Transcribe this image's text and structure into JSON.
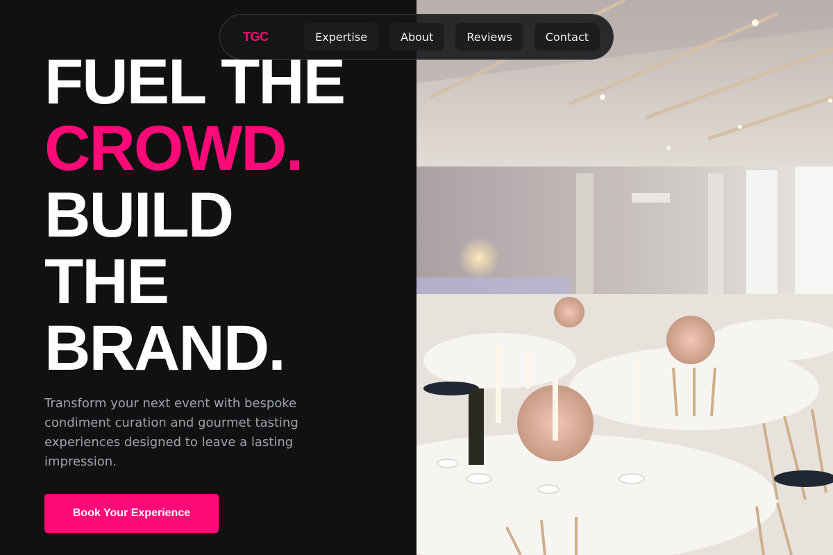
{
  "nav": {
    "brand": "TGC",
    "links": [
      {
        "label": "Expertise"
      },
      {
        "label": "About"
      },
      {
        "label": "Reviews"
      },
      {
        "label": "Contact"
      }
    ]
  },
  "hero": {
    "headline_lines": [
      "FUEL THE",
      "CROWD.",
      "BUILD",
      "THE",
      "BRAND."
    ],
    "subtitle": "Transform your next event with bespoke condiment curation and gourmet tasting experiences designed to leave a lasting impression.",
    "cta_label": "Book Your Experience"
  },
  "colors": {
    "accent": "#ff0a78",
    "background": "#111112",
    "headline": "#ffffff",
    "subtitle": "#9ea3ad"
  },
  "photo": {
    "subject": "banquet-hall-photo"
  }
}
